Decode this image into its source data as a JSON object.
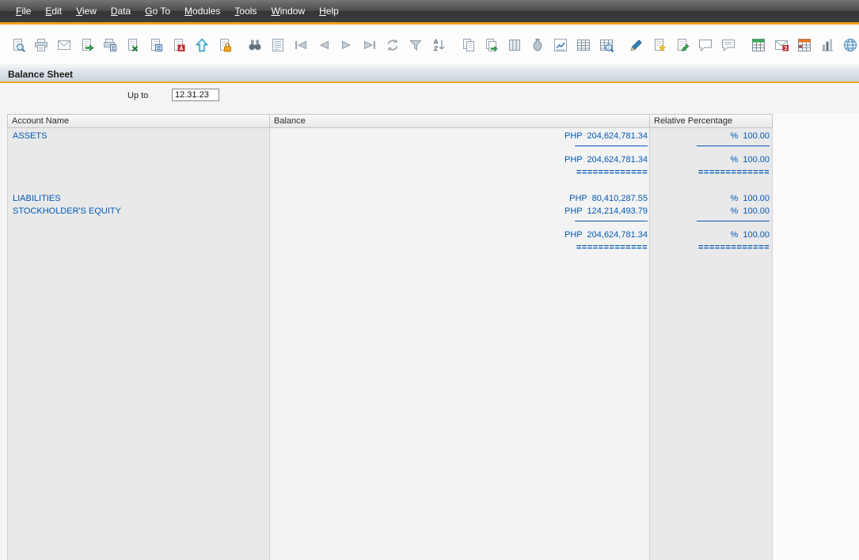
{
  "app": {
    "accent_color": "#f0a30a",
    "report_text_color": "#0059b3"
  },
  "menu_bar": {
    "items": [
      {
        "label": "File"
      },
      {
        "label": "Edit"
      },
      {
        "label": "View"
      },
      {
        "label": "Data"
      },
      {
        "label": "Go To"
      },
      {
        "label": "Modules"
      },
      {
        "label": "Tools"
      },
      {
        "label": "Window"
      },
      {
        "label": "Help"
      }
    ]
  },
  "toolbar": {
    "groups": [
      {
        "items": [
          {
            "name": "print-preview-icon",
            "glyph": "page-search"
          },
          {
            "name": "print-icon",
            "glyph": "printer"
          },
          {
            "name": "email-icon",
            "glyph": "envelope"
          },
          {
            "name": "export-icon",
            "glyph": "page-out"
          },
          {
            "name": "print-setup-icon",
            "glyph": "printer-calc"
          },
          {
            "name": "export-excel-icon",
            "glyph": "page-x"
          },
          {
            "name": "export-document-icon",
            "glyph": "page-note"
          },
          {
            "name": "export-pdf-icon",
            "glyph": "page-pdf"
          },
          {
            "name": "upload-icon",
            "glyph": "arrow-up"
          },
          {
            "name": "protected-report-icon",
            "glyph": "page-lock"
          }
        ]
      },
      {
        "items": [
          {
            "name": "find-icon",
            "glyph": "binoculars"
          },
          {
            "name": "report-list-icon",
            "glyph": "list"
          },
          {
            "name": "first-record-icon",
            "glyph": "nav-first"
          },
          {
            "name": "previous-record-icon",
            "glyph": "nav-prev"
          },
          {
            "name": "next-record-icon",
            "glyph": "nav-next"
          },
          {
            "name": "last-record-icon",
            "glyph": "nav-last"
          },
          {
            "name": "refresh-icon",
            "glyph": "refresh"
          },
          {
            "name": "filter-icon",
            "glyph": "funnel"
          },
          {
            "name": "sort-icon",
            "glyph": "sort-az"
          }
        ]
      },
      {
        "items": [
          {
            "name": "copy-icon",
            "glyph": "copy"
          },
          {
            "name": "copy-to-icon",
            "glyph": "copy-arrow"
          },
          {
            "name": "columns-icon",
            "glyph": "columns"
          },
          {
            "name": "archive-icon",
            "glyph": "jar"
          },
          {
            "name": "chart-icon",
            "glyph": "chart-up"
          },
          {
            "name": "table-icon",
            "glyph": "grid"
          },
          {
            "name": "table-search-icon",
            "glyph": "grid-search"
          }
        ]
      },
      {
        "items": [
          {
            "name": "edit-icon",
            "glyph": "pencil"
          },
          {
            "name": "new-note-icon",
            "glyph": "page-new"
          },
          {
            "name": "edit-note-icon",
            "glyph": "page-edit"
          },
          {
            "name": "comment-icon",
            "glyph": "bubble"
          },
          {
            "name": "comments-icon",
            "glyph": "bubble-lines"
          }
        ]
      },
      {
        "items": [
          {
            "name": "schedule-icon",
            "glyph": "grid-green"
          },
          {
            "name": "mail-alert-icon",
            "glyph": "envelope-red"
          },
          {
            "name": "summary-table-icon",
            "glyph": "grid-red"
          },
          {
            "name": "bar-chart-icon",
            "glyph": "chart-bars"
          },
          {
            "name": "web-icon",
            "glyph": "globe"
          }
        ]
      }
    ]
  },
  "document": {
    "title": "Balance Sheet"
  },
  "filter": {
    "label": "Up to",
    "value": "12.31.23"
  },
  "report": {
    "columns": [
      {
        "label": "Account Name"
      },
      {
        "label": "Balance"
      },
      {
        "label": "Relative Percentage"
      }
    ],
    "currency": "PHP",
    "rows": [
      {
        "type": "detail",
        "name": "ASSETS",
        "balance": "PHP  204,624,781.34",
        "percent": "%  100.00"
      },
      {
        "type": "rule"
      },
      {
        "type": "total",
        "name": "",
        "balance": "PHP  204,624,781.34",
        "percent": "%  100.00"
      },
      {
        "type": "double-rule",
        "name": "",
        "balance": "=============",
        "percent": "============="
      },
      {
        "type": "spacer"
      },
      {
        "type": "detail",
        "name": "LIABILITIES",
        "balance": "PHP  80,410,287.55",
        "percent": "%  100.00"
      },
      {
        "type": "detail",
        "name": "STOCKHOLDER'S EQUITY",
        "balance": "PHP  124,214,493.79",
        "percent": "%  100.00"
      },
      {
        "type": "rule"
      },
      {
        "type": "total",
        "name": "",
        "balance": "PHP  204,624,781.34",
        "percent": "%  100.00"
      },
      {
        "type": "double-rule",
        "name": "",
        "balance": "=============",
        "percent": "============="
      }
    ]
  }
}
